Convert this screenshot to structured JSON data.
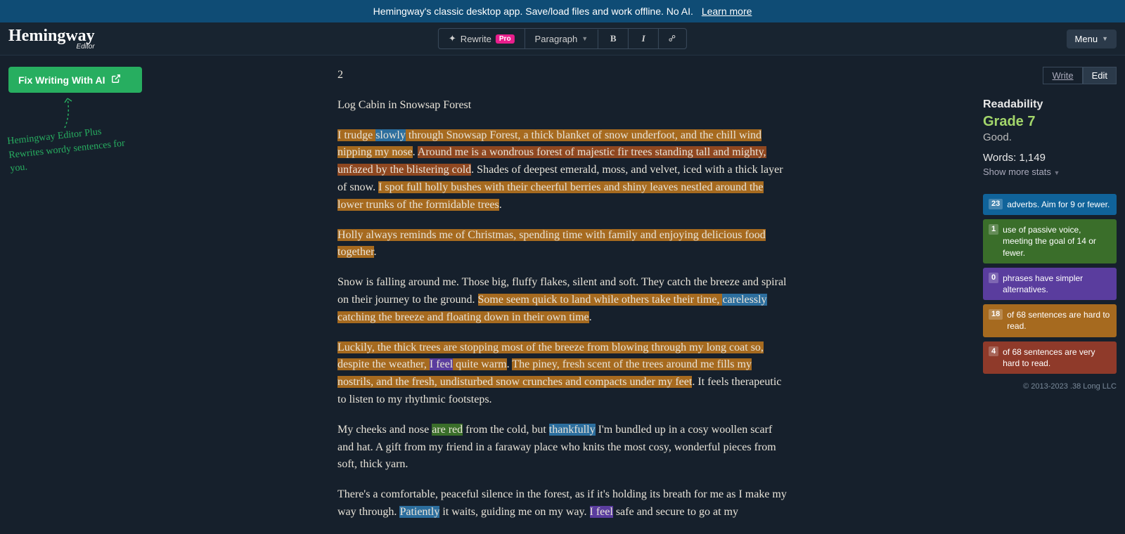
{
  "banner": {
    "text": "Hemingway's classic desktop app. Save/load files and work offline. No AI.",
    "link": "Learn more"
  },
  "brand": {
    "name": "Hemingway",
    "sub": "Editor"
  },
  "toolbar": {
    "rewrite": "Rewrite",
    "pro": "Pro",
    "paragraph": "Paragraph",
    "menu": "Menu"
  },
  "left": {
    "fix": "Fix Writing With AI",
    "tag1": "Hemingway Editor Plus",
    "tag2": "Rewrites wordy sentences for you."
  },
  "modes": {
    "write": "Write",
    "edit": "Edit"
  },
  "readability": {
    "label": "Readability",
    "grade": "Grade 7",
    "good": "Good.",
    "words_label": "Words:",
    "words_count": "1,149",
    "more": "Show more stats"
  },
  "cards": {
    "adv": {
      "n": "23",
      "t": "adverbs. Aim for 9 or fewer."
    },
    "pass": {
      "n": "1",
      "t": "use of passive voice, meeting the goal of 14 or fewer."
    },
    "simpler": {
      "n": "0",
      "t": "phrases have simpler alternatives."
    },
    "hard": {
      "n": "18",
      "t": "of 68 sentences are hard to read."
    },
    "vhard": {
      "n": "4",
      "t": "of 68 sentences are very hard to read."
    }
  },
  "footer": "© 2013-2023 .38 Long LLC",
  "doc": {
    "num": "2",
    "title": "Log Cabin in Snowsap Forest",
    "p1a": "I trudge ",
    "p1_adv1": "slowly",
    "p1b": " through Snowsap Forest, a thick blanket of snow underfoot, and the chill wind nipping my nose",
    "p1c": ". ",
    "p1d": "Around me is a wondrous forest of majestic fir trees standing tall and mighty, unfazed by the blistering cold",
    "p1e": ". ",
    "p1f": "Shades of deepest emerald, moss, and velvet, iced with a thick layer of snow. ",
    "p1g": "I spot full holly bushes with their cheerful berries and shiny leaves nestled around the lower trunks of the formidable trees",
    "p1h": ".",
    "p2a": "Holly always reminds me of Christmas, spending time with family and enjoying delicious food together",
    "p2b": ".",
    "p3a": "Snow is falling around me. Those big, fluffy flakes, silent and soft. They catch the breeze and spiral on their journey to the ground. ",
    "p3b": "Some seem quick to land while others take their time, ",
    "p3_adv": "carelessly",
    "p3c": " catching the breeze and floating down in their own time",
    "p3d": ".",
    "p4a": "Luckily, the thick trees are stopping most of the breeze from blowing through my long coat so, despite the weather, ",
    "p4_weak": "I feel",
    "p4b": " quite warm",
    "p4c": ". ",
    "p4d": "The piney, fresh scent of the trees around me fills my nostrils, and the fresh, undisturbed snow crunches and compacts under my feet",
    "p4e": ". It feels therapeutic to listen to my rhythmic footsteps.",
    "p5a": "My cheeks and nose ",
    "p5_pass": "are red",
    "p5b": " from the cold, but ",
    "p5_adv": "thankfully",
    "p5c": " I'm bundled up in a cosy woollen scarf and hat. A gift from my friend in a faraway place who knits the most cosy, wonderful pieces from soft, thick yarn.",
    "p6a": "There's a comfortable, peaceful silence in the forest, as if it's holding its breath for me as I make my way through. ",
    "p6_adv": "Patiently",
    "p6b": " it waits, guiding me on my way.  ",
    "p6_weak": "I feel",
    "p6c": " safe and secure to go at my"
  }
}
